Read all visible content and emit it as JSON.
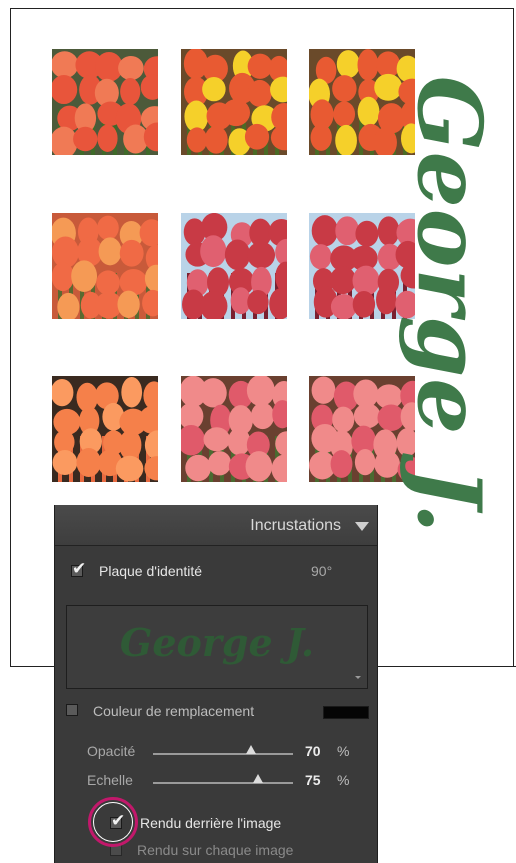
{
  "contact_sheet": {
    "identity_plate_text": "George J.",
    "thumbnails": [
      {
        "name": "thumb-r1c1",
        "sky": "#4c5a3a",
        "petal": "#e8553b",
        "accent": "#f07a55",
        "stem": "#3f6a2a"
      },
      {
        "name": "thumb-r1c2",
        "sky": "#6a4a2a",
        "petal": "#e85a32",
        "accent": "#f5d02a",
        "stem": "#4a6a25"
      },
      {
        "name": "thumb-r1c3",
        "sky": "#6a4a2a",
        "petal": "#e85a32",
        "accent": "#f5d02a",
        "stem": "#4a6a25"
      },
      {
        "name": "thumb-r2c1",
        "sky": "#c85a3a",
        "petal": "#f06a45",
        "accent": "#f59a55",
        "stem": "#5a6a30"
      },
      {
        "name": "thumb-r2c2",
        "sky": "#b9d3e8",
        "petal": "#c83a45",
        "accent": "#e06070",
        "stem": "#7a2030"
      },
      {
        "name": "thumb-r2c3",
        "sky": "#b9d3e8",
        "petal": "#c83a45",
        "accent": "#e06070",
        "stem": "#7a2030"
      },
      {
        "name": "thumb-r3c1",
        "sky": "#3a2a20",
        "petal": "#f5804a",
        "accent": "#fb9a60",
        "stem": "#e86a40"
      },
      {
        "name": "thumb-r3c2",
        "sky": "#6a4030",
        "petal": "#f08a8a",
        "accent": "#e05a6a",
        "stem": "#4a6a30"
      },
      {
        "name": "thumb-r3c3",
        "sky": "#6a4030",
        "petal": "#f08a8a",
        "accent": "#e05a6a",
        "stem": "#4a6a30"
      }
    ]
  },
  "panel": {
    "title": "Incrustations",
    "disclosure_icon": "triangle-down",
    "identity_plate": {
      "label": "Plaque d'identité",
      "checked": true,
      "rotation": "90°"
    },
    "plate_preview_text": "George J.",
    "override_color": {
      "label": "Couleur de remplacement",
      "checked": false,
      "color": "#050505"
    },
    "opacity": {
      "label": "Opacité",
      "value": "70",
      "unit": "%",
      "fraction": 0.7
    },
    "scale": {
      "label": "Echelle",
      "value": "75",
      "unit": "%",
      "fraction": 0.75
    },
    "render_behind": {
      "label": "Rendu derrière l'image",
      "checked": true
    },
    "render_on_every": {
      "label": "Rendu sur chaque image",
      "checked": false
    }
  },
  "colors": {
    "panel_bg": "#3a3a3a",
    "plate_green": "#3f7a4a",
    "highlight": "#c2186b"
  }
}
